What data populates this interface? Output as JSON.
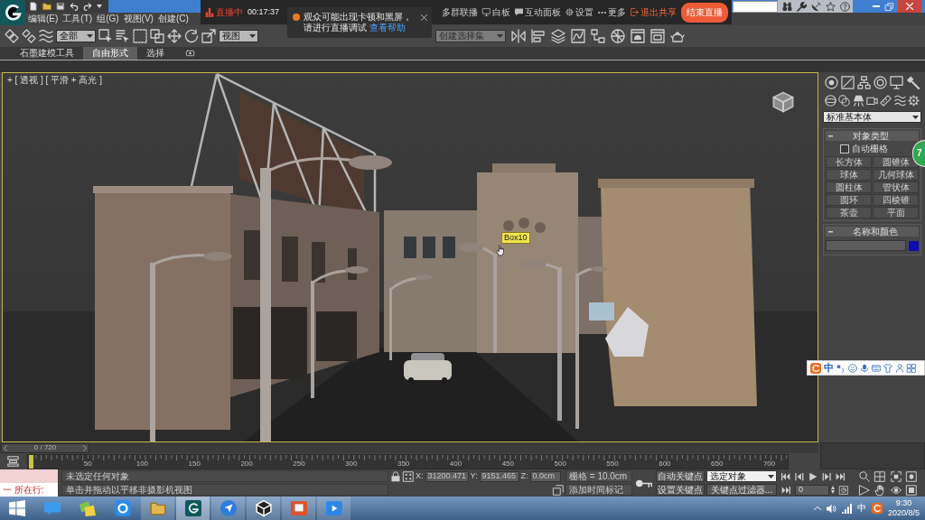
{
  "menu_bar": {
    "items": [
      "编辑(E)",
      "工具(T)",
      "组(G)",
      "视图(V)",
      "创建(C)"
    ]
  },
  "live_bar": {
    "status": "直播中",
    "timer": "00:17:37",
    "actions": [
      {
        "kind": "plain",
        "label": "多群联播"
      },
      {
        "kind": "whiteboard",
        "label": "白板"
      },
      {
        "kind": "chat",
        "label": "互动面板"
      },
      {
        "kind": "settings",
        "label": "设置"
      },
      {
        "kind": "more",
        "label": "更多"
      }
    ],
    "exit_share": "退出共享",
    "end_button": "结束直播"
  },
  "notice": {
    "message": "观众可能出现卡顿和黑屏，请进行直播调试",
    "link": "查看帮助"
  },
  "toolbar": {
    "selection_filter": "全部",
    "reference_coordinate": "视图",
    "named_selection": {
      "placeholder": "创建选择集"
    }
  },
  "ribbon": {
    "tabs": [
      {
        "label": "石墨建模工具",
        "selected": false
      },
      {
        "label": "自由形式",
        "selected": true
      },
      {
        "label": "选择",
        "selected": false
      }
    ]
  },
  "viewport": {
    "label": "+ [ 透视 ] [ 平滑 + 高光 ]",
    "active": true,
    "tooltip": "Box10"
  },
  "command_panel": {
    "category": "标准基本体",
    "object_type": {
      "title": "对象类型",
      "expanded": true,
      "autogrid": {
        "label": "自动栅格",
        "checked": false
      },
      "buttons": [
        "长方体",
        "圆锥体",
        "球体",
        "几何球体",
        "圆柱体",
        "管状体",
        "圆环",
        "四棱锥",
        "茶壶",
        "平面"
      ]
    },
    "name_and_color": {
      "title": "名称和颜色",
      "expanded": true,
      "color": "#0c0cb0"
    }
  },
  "badge": {
    "text": "7"
  },
  "ime_toolbar": {
    "mode": "中"
  },
  "time_slider": {
    "frame": "0 / 720",
    "level": 0
  },
  "track_bar": {
    "ticks": [
      "50",
      "100",
      "150",
      "200",
      "250",
      "300",
      "350",
      "400",
      "450",
      "500",
      "550",
      "600",
      "650",
      "700"
    ]
  },
  "status_bar": {
    "listener": "一 所在行:",
    "selection": "未选定任何对象",
    "prompt": "单击并拖动以平移非摄影机视图",
    "coordinates": [
      {
        "axis": "X:",
        "value": "31200.471"
      },
      {
        "axis": "Y:",
        "value": "9151.465"
      },
      {
        "axis": "Z:",
        "value": "0.0cm"
      }
    ],
    "grid": "栅格 = 10.0cm",
    "time_tag": "添加时间标记"
  },
  "animation_controls": {
    "auto_key": "自动关键点",
    "set_key": "设置关键点",
    "key_mode": "选定对象",
    "key_filters": "关键点过滤器...",
    "frame": "0"
  },
  "taskbar": {
    "apps": [
      {
        "open": false,
        "selected": false
      },
      {
        "open": false,
        "selected": false
      },
      {
        "open": false,
        "selected": false
      },
      {
        "open": true,
        "selected": false
      },
      {
        "open": true,
        "selected": true
      },
      {
        "open": true,
        "selected": false
      },
      {
        "open": true,
        "selected": false
      },
      {
        "open": true,
        "selected": false
      },
      {
        "open": true,
        "selected": false
      }
    ],
    "tray": {
      "ime": "中",
      "time": "9:30",
      "date": "2020/8/5"
    }
  }
}
